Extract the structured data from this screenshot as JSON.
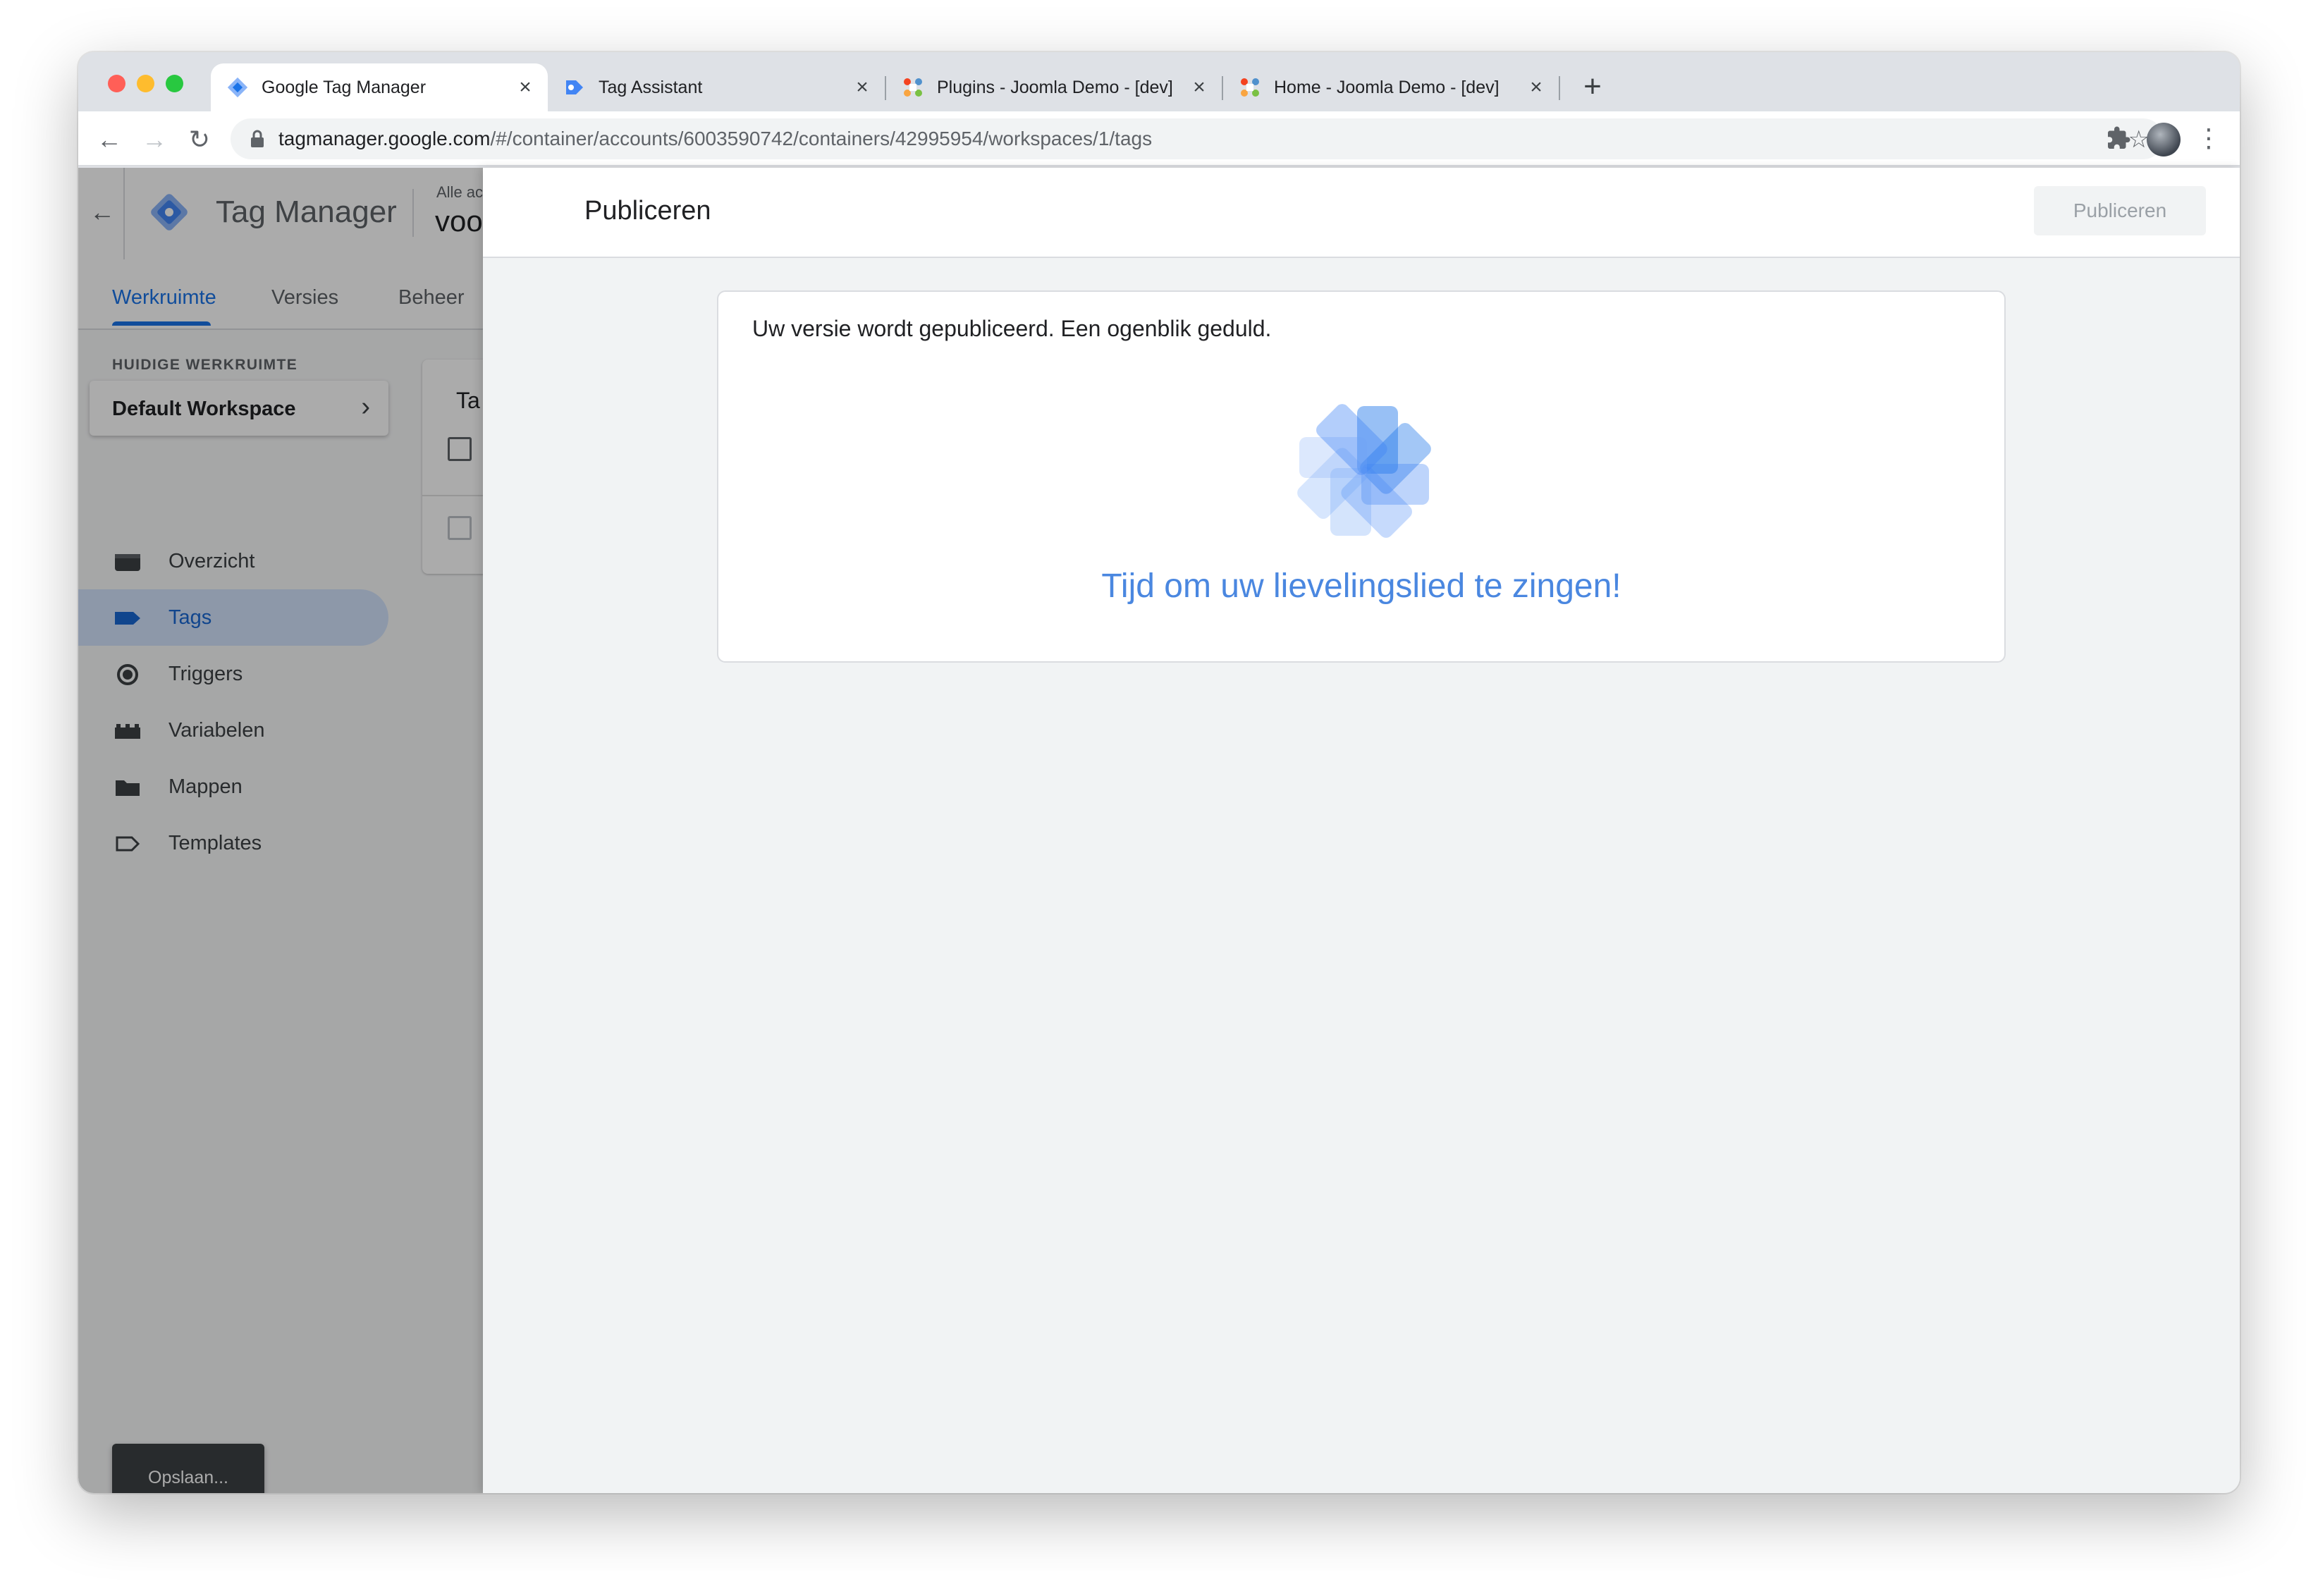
{
  "browser": {
    "tabs": [
      {
        "title": "Google Tag Manager",
        "active": true,
        "favicon": "gtm-icon"
      },
      {
        "title": "Tag Assistant",
        "active": false,
        "favicon": "tag-assistant-icon"
      },
      {
        "title": "Plugins - Joomla Demo - [dev]",
        "active": false,
        "favicon": "joomla-icon"
      },
      {
        "title": "Home - Joomla Demo - [dev]",
        "active": false,
        "favicon": "joomla-icon"
      }
    ],
    "new_tab": "+",
    "url_host": "tagmanager.google.com",
    "url_path": "/#/container/accounts/6003590742/containers/42995954/workspaces/1/tags",
    "nav": {
      "back": "←",
      "forward": "→",
      "reload": "↻",
      "star": "☆",
      "menu": "⋮"
    }
  },
  "app": {
    "back": "←",
    "name": "Tag Manager",
    "account_label": "Alle ac",
    "account_name": "voo",
    "tabs": [
      "Werkruimte",
      "Versies",
      "Beheer"
    ],
    "workspace_label": "HUIDIGE WERKRUIMTE",
    "workspace_name": "Default Workspace",
    "workspace_chevron": "›",
    "sidebar": [
      {
        "label": "Overzicht",
        "icon": "overview-icon",
        "active": false
      },
      {
        "label": "Tags",
        "icon": "tag-icon",
        "active": true
      },
      {
        "label": "Triggers",
        "icon": "trigger-icon",
        "active": false
      },
      {
        "label": "Variabelen",
        "icon": "variables-icon",
        "active": false
      },
      {
        "label": "Mappen",
        "icon": "folder-icon",
        "active": false
      },
      {
        "label": "Templates",
        "icon": "template-icon",
        "active": false
      }
    ],
    "card_peek_title": "Ta",
    "toast": "Opslaan..."
  },
  "publish_panel": {
    "title": "Publiceren",
    "button": "Publiceren",
    "message": "Uw versie wordt gepubliceerd. Een ogenblik geduld.",
    "fun_text": "Tijd om uw lievelingslied te zingen!"
  },
  "colors": {
    "accent": "#1a73e8",
    "active_nav_bg": "#d2e3fc",
    "spinner_blue": "#4285f4"
  }
}
